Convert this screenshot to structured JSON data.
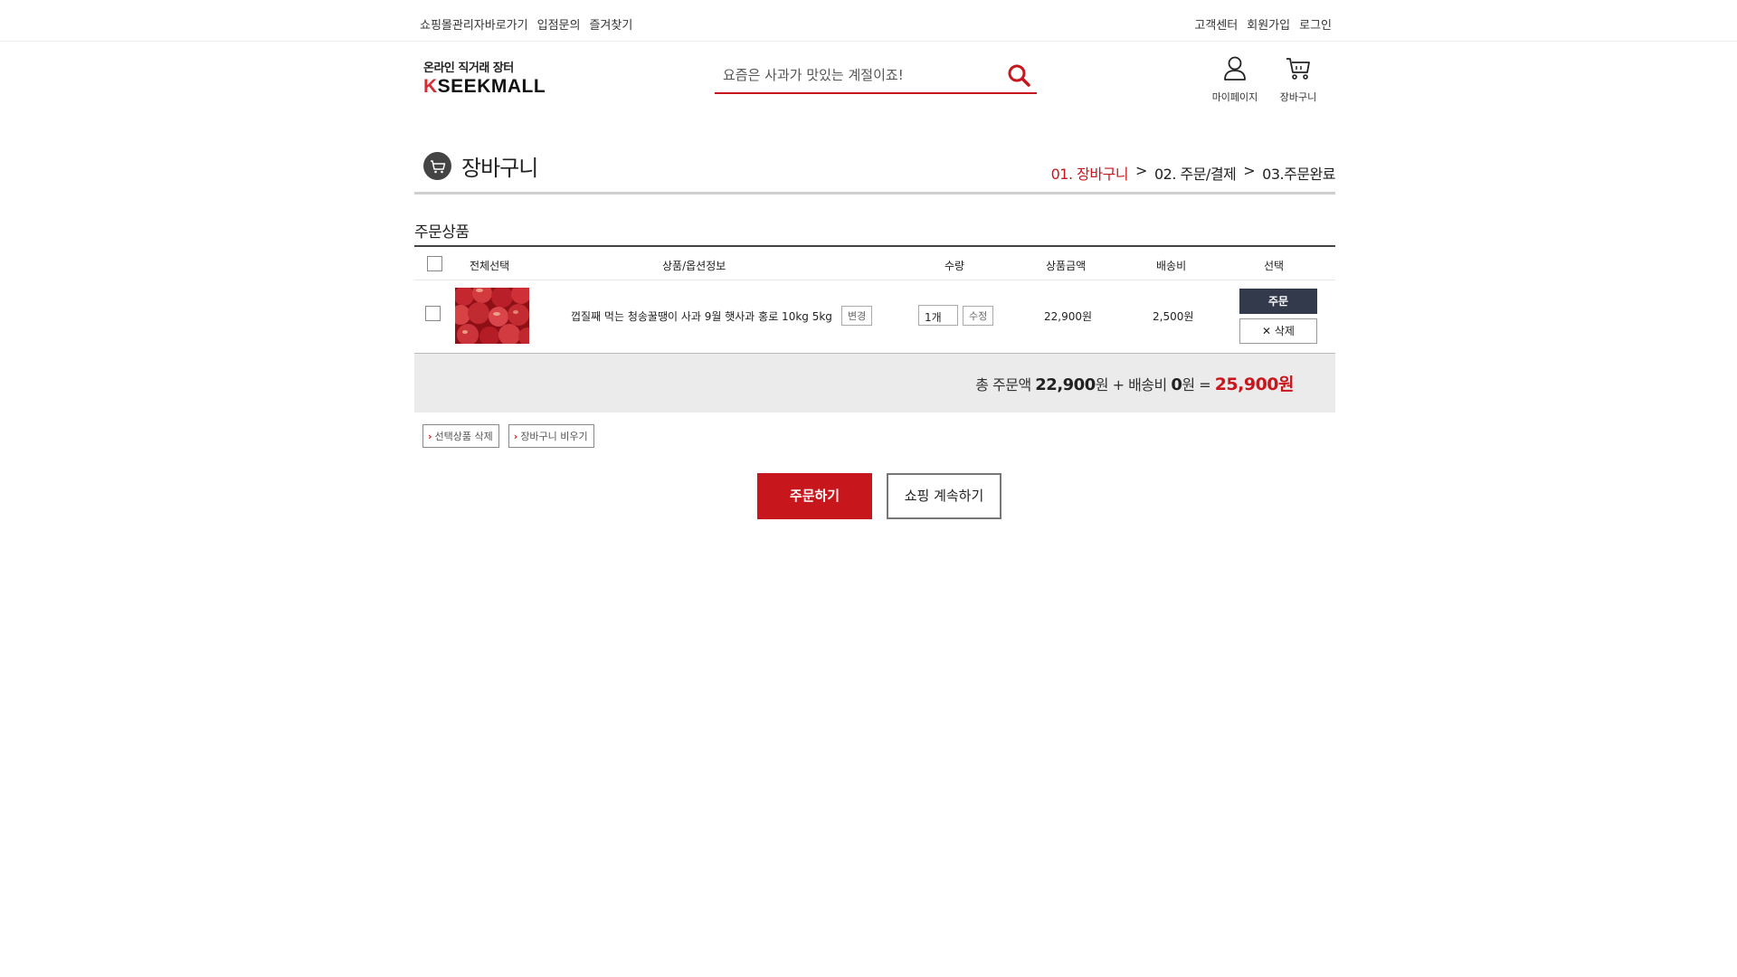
{
  "topbar": {
    "left": [
      "쇼핑몰관리자바로가기",
      "입점문의",
      "즐겨찾기"
    ],
    "right": [
      "고객센터",
      "회원가입",
      "로그인"
    ]
  },
  "logo": {
    "sub": "온라인 직거래 장터",
    "k": "K",
    "rest": "SEEKMALL"
  },
  "search": {
    "placeholder": "요즘은 사과가 맛있는 계절이죠!"
  },
  "header_icons": {
    "mypage": "마이페이지",
    "cart": "장바구니"
  },
  "page": {
    "title": "장바구니",
    "steps": {
      "s1": "01. 장바구니",
      "sep1": ">",
      "s2": "02. 주문/결제",
      "sep2": ">",
      "s3": "03.주문완료"
    }
  },
  "section_title": "주문상품",
  "table": {
    "headers": {
      "select_all": "전체선택",
      "product": "상품/옵션정보",
      "qty": "수량",
      "price": "상품금액",
      "shipping": "배송비",
      "choice": "선택"
    },
    "rows": [
      {
        "name": "껍질째 먹는 청송꿀땡이 사과 9월 햇사과 홍로 10kg 5kg",
        "change_label": "변경",
        "qty": "1개",
        "modify_label": "수정",
        "price": "22,900원",
        "shipping": "2,500원",
        "order_label": "주문",
        "delete_label": "삭제"
      }
    ]
  },
  "totals": {
    "label": "총 주문액",
    "order_amount": "22,900",
    "unit": "원",
    "plus": "+",
    "shipping_label": "배송비",
    "shipping_amount": "0",
    "equals": "=",
    "grand_total": "25,900원"
  },
  "actions": {
    "delete_selected": "선택상품 삭제",
    "empty_cart": "장바구니 비우기"
  },
  "buttons": {
    "order": "주문하기",
    "continue": "쇼핑 계속하기"
  },
  "colors": {
    "accent": "#c8161d",
    "dark_button": "#333a4c"
  },
  "icons": {
    "search": "search-icon",
    "user": "user-icon",
    "cart": "cart-icon"
  }
}
